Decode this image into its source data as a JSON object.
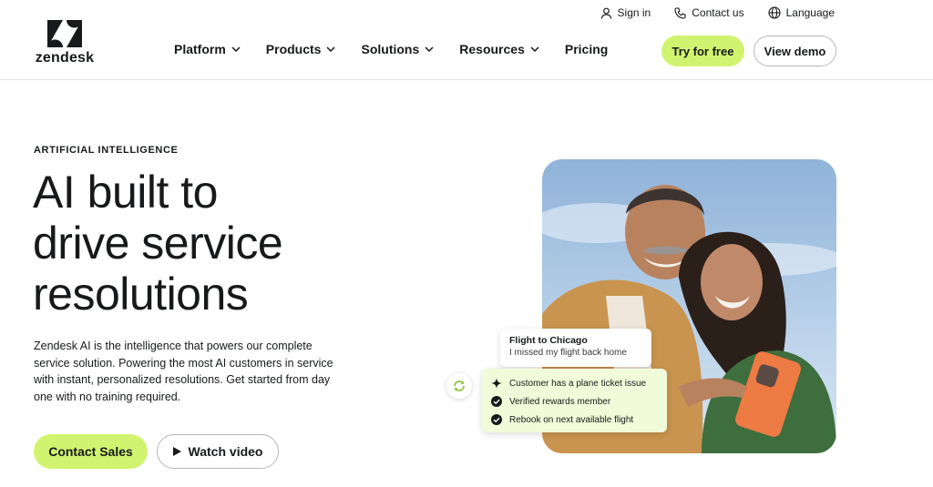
{
  "brand": {
    "name": "zendesk"
  },
  "utility": {
    "sign_in": "Sign in",
    "contact_us": "Contact us",
    "language": "Language"
  },
  "nav": {
    "items": [
      {
        "label": "Platform",
        "has_dropdown": true
      },
      {
        "label": "Products",
        "has_dropdown": true
      },
      {
        "label": "Solutions",
        "has_dropdown": true
      },
      {
        "label": "Resources",
        "has_dropdown": true
      },
      {
        "label": "Pricing",
        "has_dropdown": false
      }
    ],
    "try_free": "Try for free",
    "view_demo": "View demo"
  },
  "hero": {
    "eyebrow": "ARTIFICIAL INTELLIGENCE",
    "headline": [
      "AI built to",
      "drive service",
      "resolutions"
    ],
    "description": "Zendesk AI is the intelligence that powers our complete service solution. Powering the most AI customers in service with instant, personalized resolutions. Get started from day one with no training required.",
    "contact_sales": "Contact Sales",
    "watch_video": "Watch video"
  },
  "chat": {
    "flight_title": "Flight to Chicago",
    "flight_message": "I missed my flight back home",
    "ai_items": [
      {
        "icon": "sparkle-icon",
        "text": "Customer has a plane ticket issue"
      },
      {
        "icon": "check-circle-icon",
        "text": "Verified rewards member"
      },
      {
        "icon": "check-circle-icon",
        "text": "Rebook on next available flight"
      }
    ]
  },
  "colors": {
    "accent": "#d1f470",
    "text": "#17191a",
    "border": "#b8b8b8",
    "ai_card_bg": "#f2fbd9"
  }
}
